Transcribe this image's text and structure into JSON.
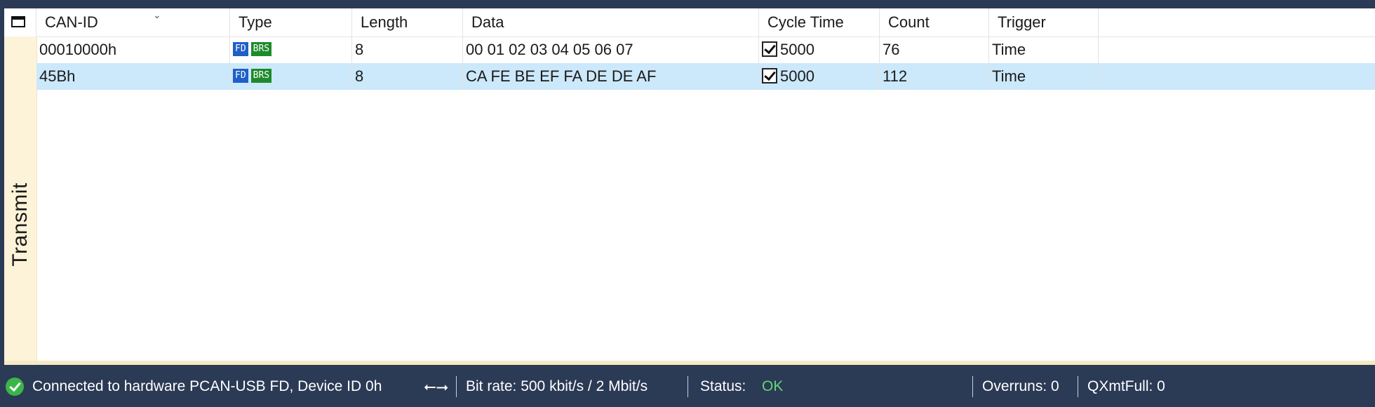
{
  "side_tab": {
    "label": "Transmit"
  },
  "table": {
    "columns": [
      "CAN-ID",
      "Type",
      "Length",
      "Data",
      "Cycle Time",
      "Count",
      "Trigger"
    ],
    "rows": [
      {
        "can_id": "00010000h",
        "type_badges": [
          "FD",
          "BRS"
        ],
        "length": "8",
        "data": "00 01 02 03 04 05 06 07",
        "cycle_enabled": true,
        "cycle_time": "5000",
        "count": "76",
        "trigger": "Time",
        "selected": false
      },
      {
        "can_id": "45Bh",
        "type_badges": [
          "FD",
          "BRS"
        ],
        "length": "8",
        "data": "CA FE BE EF FA DE DE AF",
        "cycle_enabled": true,
        "cycle_time": "5000",
        "count": "112",
        "trigger": "Time",
        "selected": true
      }
    ]
  },
  "status_bar": {
    "connection": "Connected to hardware PCAN-USB FD, Device ID 0h",
    "connection_icon": "check-circle-icon",
    "usb_icon": "usb-icon",
    "bitrate": "Bit rate: 500 kbit/s / 2 Mbit/s",
    "status_label": "Status:",
    "status_value": "OK",
    "overruns": "Overruns: 0",
    "qxmtfull": "QXmtFull: 0"
  },
  "colors": {
    "status_bar_bg": "#2b3a55",
    "selected_row": "#cce8fb",
    "fd_badge": "#1f5fc9",
    "brs_badge": "#1d8a2b",
    "ok_green": "#67d37a",
    "side_tab_bg": "#fdf3d8"
  }
}
